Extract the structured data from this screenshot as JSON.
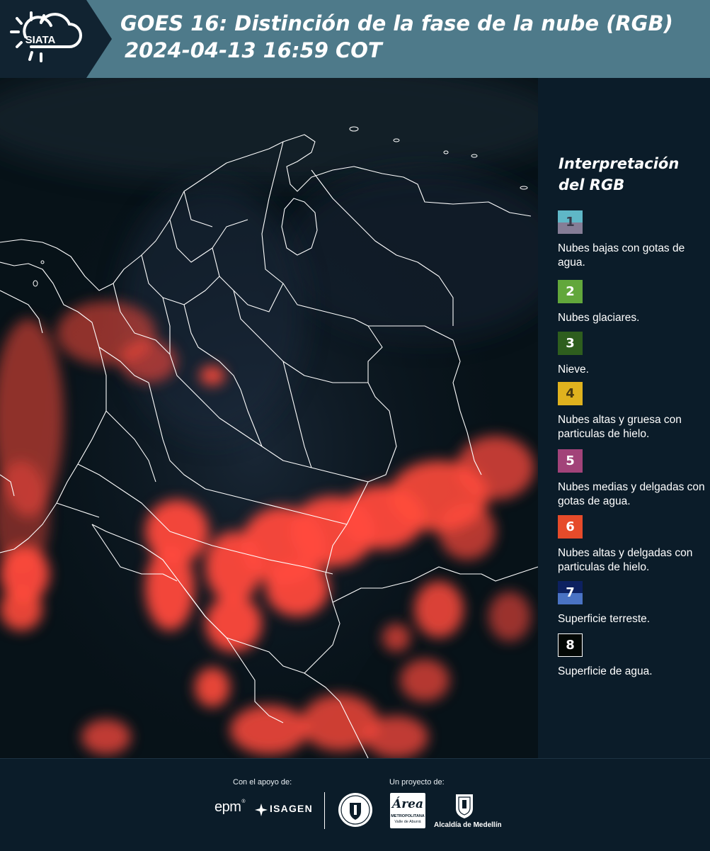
{
  "header": {
    "logo_text": "SIATA",
    "title_line1": "GOES 16: Distinción de la fase de la nube (RGB)",
    "title_line2": "2024-04-13 16:59 COT"
  },
  "legend": {
    "title_line1": "Interpretación",
    "title_line2": "del RGB",
    "items": [
      {
        "number": "1",
        "label": "Nubes bajas con gotas de agua.",
        "color_top": "#5fb7c7",
        "color_bottom": "#857d96",
        "text_color": "#3a3a4a"
      },
      {
        "number": "2",
        "label": "Nubes glaciares.",
        "color_top": "#62a73b",
        "color_bottom": "#62a73b",
        "text_color": "#ffffff"
      },
      {
        "number": "3",
        "label": "Nieve.",
        "color_top": "#2e5e1e",
        "color_bottom": "#2e5e1e",
        "text_color": "#ffffff"
      },
      {
        "number": "4",
        "label": "Nubes altas y gruesa con particulas de hielo.",
        "color_top": "#e0b21e",
        "color_bottom": "#e0b21e",
        "text_color": "#4a3a10"
      },
      {
        "number": "5",
        "label": "Nubes medias y delgadas con gotas de agua.",
        "color_top": "#a24379",
        "color_bottom": "#a24379",
        "text_color": "#ffffff"
      },
      {
        "number": "6",
        "label": "Nubes altas y delgadas con particulas de hielo.",
        "color_top": "#e64b2a",
        "color_bottom": "#e64b2a",
        "text_color": "#ffffff"
      },
      {
        "number": "7",
        "label": "Superficie terreste.",
        "color_top": "#0d2160",
        "color_bottom": "#4a73c4",
        "text_color": "#ffffff"
      },
      {
        "number": "8",
        "label": "Superficie de agua.",
        "color_top": "#030805",
        "color_bottom": "#030805",
        "text_color": "#ffffff"
      }
    ]
  },
  "footer": {
    "support_label": "Con el apoyo de:",
    "project_label": "Un proyecto de:",
    "epm": "epm",
    "isagen": "ISAGEN",
    "area_logo_text": "Área",
    "area_sub1": "METROPOLITANA",
    "area_sub2": "Valle de Aburrá",
    "alcaldia": "Alcaldía de Medellín"
  },
  "colors": {
    "header_bg": "#4e7a8a",
    "panel_bg": "#0b1c29",
    "cloud_red": "#ff4a3c",
    "border_white": "#ffffff"
  }
}
